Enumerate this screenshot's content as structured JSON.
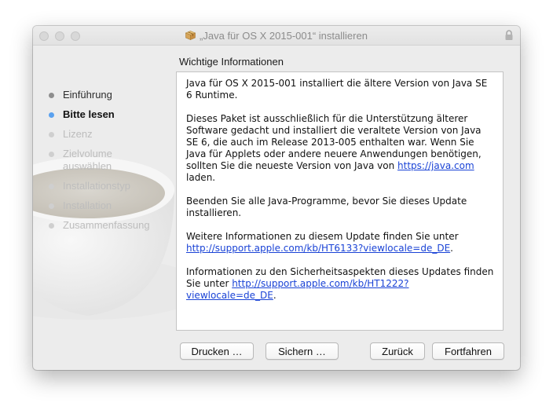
{
  "window": {
    "title": "„Java für OS X 2015-001“ installieren"
  },
  "sidebar": {
    "steps": [
      {
        "label": "Einführung",
        "state": "done"
      },
      {
        "label": "Bitte lesen",
        "state": "current"
      },
      {
        "label": "Lizenz",
        "state": "pending"
      },
      {
        "label": "Zielvolume",
        "label2": "auswählen",
        "state": "pending"
      },
      {
        "label": "Installationstyp",
        "state": "pending"
      },
      {
        "label": "Installation",
        "state": "pending"
      },
      {
        "label": "Zusammenfassung",
        "state": "pending"
      }
    ]
  },
  "main": {
    "section_title": "Wichtige Informationen",
    "p1": "Java für OS X 2015-001 installiert die ältere Version von Java SE 6 Runtime.",
    "p2_text": "Dieses Paket ist ausschließlich für die Unterstützung älterer Software gedacht und installiert die veraltete Version von Java SE 6, die auch im Release 2013-005 enthalten war. Wenn Sie Java für Applets oder andere neuere Anwendungen benötigen, sollten Sie die neueste Version von Java von ",
    "p2_link": "https://java.com",
    "p2_tail": " laden.",
    "p3": "Beenden Sie alle Java-Programme, bevor Sie dieses Update installieren.",
    "p4_text": "Weitere Informationen zu diesem Update finden Sie unter ",
    "p4_link": "http://support.apple.com/kb/HT6133?viewlocale=de_DE",
    "p4_tail": ".",
    "p5_text": "Informationen zu den Sicherheitsaspekten dieses Updates finden Sie unter ",
    "p5_link": "http://support.apple.com/kb/HT1222?viewlocale=de_DE",
    "p5_tail": "."
  },
  "buttons": {
    "print": "Drucken …",
    "save": "Sichern …",
    "back": "Zurück",
    "continue": "Fortfahren"
  },
  "colors": {
    "accent": "#5aa1ef",
    "link": "#1a43d6"
  },
  "icons": {
    "title_icon": "package-icon",
    "lock": "lock-icon"
  }
}
